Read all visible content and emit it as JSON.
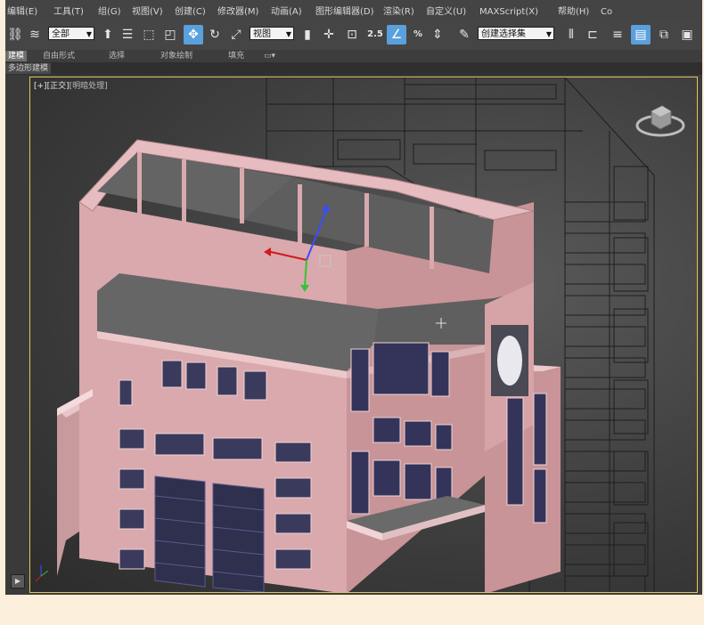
{
  "menubar": {
    "items": [
      "编辑(E)",
      "工具(T)",
      "组(G)",
      "视图(V)",
      "创建(C)",
      "修改器(M)",
      "动画(A)",
      "图形编辑器(D)",
      "渲染(R)",
      "自定义(U)",
      "MAXScript(X)",
      "帮助(H)",
      "Co"
    ]
  },
  "toolbar": {
    "selection_filter": "全部",
    "ref_coord": "视图",
    "named_selection": "创建选择集",
    "snap_labels": {
      "angle": "2.5",
      "percent": "%"
    }
  },
  "ribbon": {
    "tabs": [
      "建模",
      "自由形式",
      "选择",
      "对象绘制",
      "填充"
    ],
    "active_tab": "建模"
  },
  "subbar": {
    "label": "多边形建模"
  },
  "viewport": {
    "label_plus": "[+]",
    "label_view": "[正交]",
    "label_shading": "[明暗处理]",
    "border_color": "#e5c35a"
  },
  "colors": {
    "building_wall": "#d9a9ad",
    "building_slab": "#646464",
    "window_glass": "#3a3a5c",
    "accent_blue": "#5aa0dc"
  },
  "icons": [
    "selection-region-icon",
    "select-move-icon",
    "rotate-icon",
    "scale-icon",
    "snap-toggle-icon",
    "angle-snap-icon",
    "mirror-icon",
    "align-icon",
    "render-setup-icon",
    "view-cube-icon"
  ]
}
